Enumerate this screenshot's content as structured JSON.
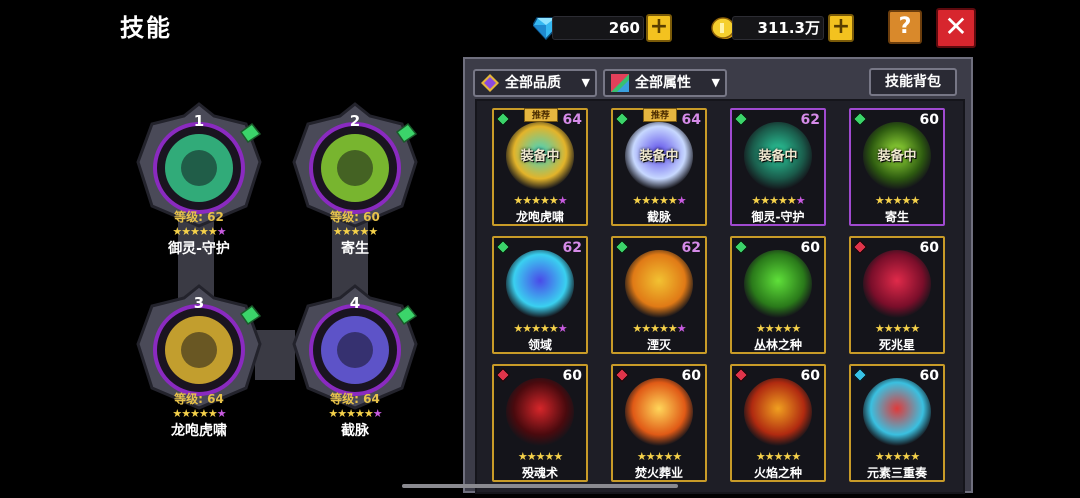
{
  "header": {
    "title": "技能"
  },
  "currency": {
    "gems": "260",
    "coins": "311.3万",
    "gem_icon": "diamond-icon",
    "coin_icon": "coin-icon"
  },
  "buttons": {
    "help": "?",
    "close": "✕",
    "plus": "+"
  },
  "equipped": [
    {
      "slot": "1",
      "level_label": "等级: 62",
      "stars": "★★★★★★",
      "name": "御灵-守护",
      "icon": "guardian-rune-icon",
      "color": "#36c58a"
    },
    {
      "slot": "2",
      "level_label": "等级: 60",
      "stars": "★★★★★",
      "name": "寄生",
      "icon": "parasite-icon",
      "color": "#8ad132"
    },
    {
      "slot": "3",
      "level_label": "等级: 64",
      "stars": "★★★★★★",
      "name": "龙咆虎啸",
      "icon": "dragon-roar-icon",
      "color": "#e0b631"
    },
    {
      "slot": "4",
      "level_label": "等级: 64",
      "stars": "★★★★★★",
      "name": "截脉",
      "icon": "lightning-icon",
      "color": "#6a5ee6"
    }
  ],
  "filters": {
    "quality": "全部品质",
    "attribute": "全部属性",
    "bag": "技能背包"
  },
  "skills": [
    {
      "name": "龙咆虎啸",
      "level": "64",
      "stars": "★★★★★★",
      "equipped": "装备中",
      "recommend": "推荐",
      "rarity": "g",
      "border": "gold",
      "lvcolor": "pl",
      "c1": "#3ed6c6",
      "c2": "#e3b42a"
    },
    {
      "name": "截脉",
      "level": "64",
      "stars": "★★★★★★",
      "equipped": "装备中",
      "recommend": "推荐",
      "rarity": "g",
      "border": "gold",
      "lvcolor": "pl",
      "c1": "#5b4ae8",
      "c2": "#c7d8ff"
    },
    {
      "name": "御灵-守护",
      "level": "62",
      "stars": "★★★★★★",
      "equipped": "装备中",
      "recommend": "",
      "rarity": "g",
      "border": "purple",
      "lvcolor": "pl",
      "c1": "#2bd0a0",
      "c2": "#1a5a4a"
    },
    {
      "name": "寄生",
      "level": "60",
      "stars": "★★★★★",
      "equipped": "装备中",
      "recommend": "",
      "rarity": "g",
      "border": "purple",
      "lvcolor": "wh",
      "c1": "#9be43a",
      "c2": "#2d5a10"
    },
    {
      "name": "领域",
      "level": "62",
      "stars": "★★★★★★",
      "equipped": "",
      "recommend": "",
      "rarity": "g",
      "border": "gold",
      "lvcolor": "pl",
      "c1": "#4a4ae8",
      "c2": "#3ad0f0"
    },
    {
      "name": "湮灭",
      "level": "62",
      "stars": "★★★★★★",
      "equipped": "",
      "recommend": "",
      "rarity": "g",
      "border": "gold",
      "lvcolor": "pl",
      "c1": "#f2c232",
      "c2": "#e07a16"
    },
    {
      "name": "丛林之种",
      "level": "60",
      "stars": "★★★★★",
      "equipped": "",
      "recommend": "",
      "rarity": "g",
      "border": "gold",
      "lvcolor": "wh",
      "c1": "#5fe03a",
      "c2": "#2a7a1a"
    },
    {
      "name": "死兆星",
      "level": "60",
      "stars": "★★★★★",
      "equipped": "",
      "recommend": "",
      "rarity": "r",
      "border": "gold",
      "lvcolor": "wh",
      "c1": "#e02a4a",
      "c2": "#7a0e2a"
    },
    {
      "name": "殁魂术",
      "level": "60",
      "stars": "★★★★★",
      "equipped": "",
      "recommend": "",
      "rarity": "r",
      "border": "gold",
      "lvcolor": "wh",
      "c1": "#d6262a",
      "c2": "#4a0a0e"
    },
    {
      "name": "焚火葬业",
      "level": "60",
      "stars": "★★★★★",
      "equipped": "",
      "recommend": "",
      "rarity": "r",
      "border": "gold",
      "lvcolor": "wh",
      "c1": "#ffd65a",
      "c2": "#e05a16"
    },
    {
      "name": "火焰之种",
      "level": "60",
      "stars": "★★★★★",
      "equipped": "",
      "recommend": "",
      "rarity": "r",
      "border": "gold",
      "lvcolor": "wh",
      "c1": "#f0a020",
      "c2": "#b02a10"
    },
    {
      "name": "元素三重奏",
      "level": "60",
      "stars": "★★★★★",
      "equipped": "",
      "recommend": "",
      "rarity": "b",
      "border": "gold",
      "lvcolor": "wh",
      "c1": "#e03a3a",
      "c2": "#3ac0e0"
    }
  ]
}
